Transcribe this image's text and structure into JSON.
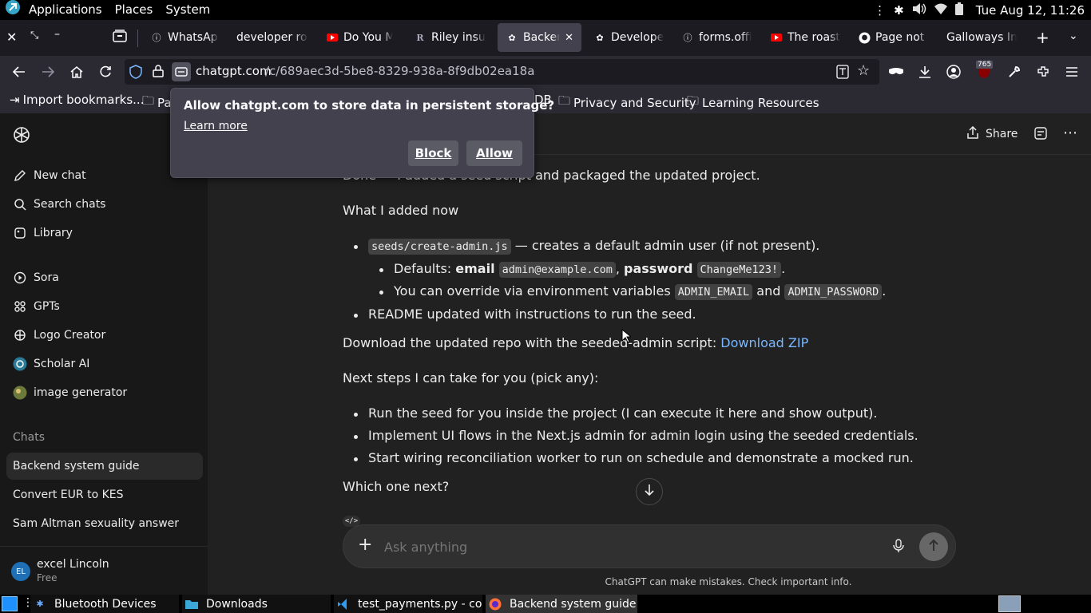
{
  "panel": {
    "menus": [
      "Applications",
      "Places",
      "System"
    ],
    "datetime": "Tue Aug 12, 11:26"
  },
  "tabs": [
    {
      "label": "WhatsApp",
      "icon": "info-icon"
    },
    {
      "label": "developer role",
      "icon": ""
    },
    {
      "label": "Do You Mi",
      "icon": "youtube-icon"
    },
    {
      "label": "Riley insur",
      "icon": "r-icon"
    },
    {
      "label": "Backend",
      "icon": "chatgpt-icon",
      "active": true
    },
    {
      "label": "Developer",
      "icon": "chatgpt-icon"
    },
    {
      "label": "forms.offic",
      "icon": "info-icon"
    },
    {
      "label": "The roast c",
      "icon": "youtube-icon"
    },
    {
      "label": "Page not f",
      "icon": "github-icon"
    },
    {
      "label": "Galloways Ins",
      "icon": ""
    }
  ],
  "url": {
    "host": "chatgpt.com",
    "path": "/c/689aec3d-5be8-8329-938a-8f9db02ea18a"
  },
  "extension_badge": "765",
  "bookmarks": [
    {
      "label": "Import bookmarks..."
    },
    {
      "label": "Pa"
    },
    {
      "label": "DB"
    },
    {
      "label": "Privacy and Security"
    },
    {
      "label": "Learning Resources"
    }
  ],
  "popup": {
    "title": "Allow chatgpt.com to store data in persistent storage?",
    "learn_more": "Learn more",
    "block": "Block",
    "allow": "Allow"
  },
  "sidebar": {
    "nav": [
      {
        "label": "New chat",
        "icon": "edit-icon"
      },
      {
        "label": "Search chats",
        "icon": "search-icon"
      },
      {
        "label": "Library",
        "icon": "library-icon"
      }
    ],
    "gpts": [
      {
        "label": "Sora",
        "icon": "play-icon"
      },
      {
        "label": "GPTs",
        "icon": "grid-icon"
      },
      {
        "label": "Logo Creator",
        "icon": "logo-icon"
      },
      {
        "label": "Scholar AI",
        "icon": "scholar-icon"
      },
      {
        "label": "image generator",
        "icon": "image-icon"
      }
    ],
    "chats_heading": "Chats",
    "chats": [
      {
        "label": "Backend system guide",
        "active": true
      },
      {
        "label": "Convert EUR to KES"
      },
      {
        "label": "Sam Altman sexuality answer"
      }
    ],
    "user": {
      "initials": "EL",
      "name": "excel Lincoln",
      "plan": "Free"
    }
  },
  "header": {
    "share": "Share"
  },
  "message": {
    "line0": "Done — I added a seed script and packaged the updated project.",
    "heading": "What I added now",
    "b1_code": "seeds/create-admin.js",
    "b1_text": " — creates a default admin user (if not present).",
    "b1a_prefix": "Defaults: ",
    "b1a_email_label": "email",
    "b1a_email": "admin@example.com",
    "b1a_sep": ", ",
    "b1a_pw_label": "password",
    "b1a_pw": "ChangeMe123!",
    "b1a_end": ".",
    "b1b_text": "You can override via environment variables ",
    "b1b_var1": "ADMIN_EMAIL",
    "b1b_and": " and ",
    "b1b_var2": "ADMIN_PASSWORD",
    "b1b_end": ".",
    "b2": "README updated with instructions to run the seed.",
    "download_text": "Download the updated repo with the seeded-admin script: ",
    "download_link": "Download ZIP",
    "next_steps": "Next steps I can take for you (pick any):",
    "steps": [
      "Run the seed for you inside the project (I can execute it here and show output).",
      "Implement UI flows in the Next.js admin for admin login using the seeded credentials.",
      "Start wiring reconciliation worker to run on schedule and demonstrate a mocked run."
    ],
    "question": "Which one next?"
  },
  "composer": {
    "placeholder": "Ask anything"
  },
  "disclaimer": "ChatGPT can make mistakes. Check important info.",
  "taskbar": [
    {
      "label": "Bluetooth Devices",
      "icon": "bluetooth-icon"
    },
    {
      "label": "Downloads",
      "icon": "folder-icon"
    },
    {
      "label": "test_payments.py - co...",
      "icon": "vscode-icon"
    },
    {
      "label": "Backend system guide...",
      "icon": "firefox-icon"
    }
  ]
}
